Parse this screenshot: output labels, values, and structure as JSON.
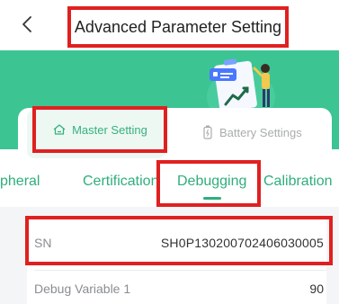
{
  "header": {
    "title": "Advanced Parameter Setting",
    "back_icon": "chevron-left-icon"
  },
  "main_tabs": [
    {
      "label": "Master Setting",
      "icon": "home-icon",
      "active": true
    },
    {
      "label": "Battery Settings",
      "icon": "battery-icon",
      "active": false
    }
  ],
  "sub_tabs": [
    {
      "label": "pheral",
      "active": false
    },
    {
      "label": "Certification",
      "active": false
    },
    {
      "label": "Debugging",
      "active": true
    },
    {
      "label": "Calibration",
      "active": false
    }
  ],
  "rows": [
    {
      "label": "SN",
      "value": "SH0P130200702406030005"
    },
    {
      "label": "Debug Variable 1",
      "value": "90"
    }
  ],
  "colors": {
    "brand_green": "#3cc493",
    "active_text": "#33b27f",
    "highlight_red": "#e02020"
  }
}
